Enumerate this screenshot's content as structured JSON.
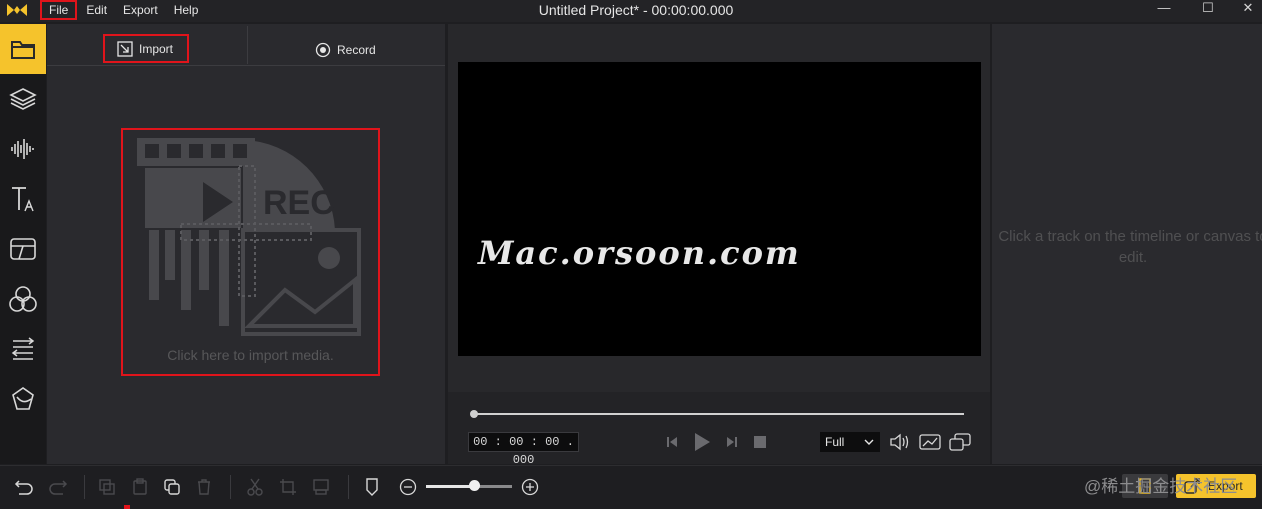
{
  "window": {
    "title": "Untitled Project* - 00:00:00.000",
    "minimize_glyph": "—",
    "maximize_glyph": "☐",
    "close_glyph": "✕"
  },
  "menu": {
    "items": [
      {
        "label": "File"
      },
      {
        "label": "Edit"
      },
      {
        "label": "Export"
      },
      {
        "label": "Help"
      }
    ]
  },
  "sidebar": {
    "items": [
      {
        "icon": "folder-icon",
        "active": true
      },
      {
        "icon": "layers-icon",
        "active": false
      },
      {
        "icon": "audio-waveform-icon",
        "active": false
      },
      {
        "icon": "text-icon",
        "active": false
      },
      {
        "icon": "transition-icon",
        "active": false
      },
      {
        "icon": "effects-icon",
        "active": false
      },
      {
        "icon": "filter-arrows-icon",
        "active": false
      },
      {
        "icon": "sticker-icon",
        "active": false
      }
    ]
  },
  "media": {
    "import_label": "Import",
    "record_label": "Record",
    "import_hint": "Click here to import media.",
    "placeholder_rec_text": "REC"
  },
  "preview": {
    "watermark": "Mac.orsoon.com",
    "timecode": "00 : 00 : 00 . 000",
    "zoom_value": "Full",
    "progress": 0
  },
  "properties": {
    "hint": "Click a track on the timeline or canvas to edit."
  },
  "toolbar": {
    "export_label": "Export",
    "watermark": "@稀土掘金技术社区",
    "zoom_level": 0.56
  },
  "colors": {
    "accent": "#f5c32c",
    "highlight_box": "#e0141b",
    "background": "#1e1e21",
    "panel": "#2a2a2e"
  }
}
